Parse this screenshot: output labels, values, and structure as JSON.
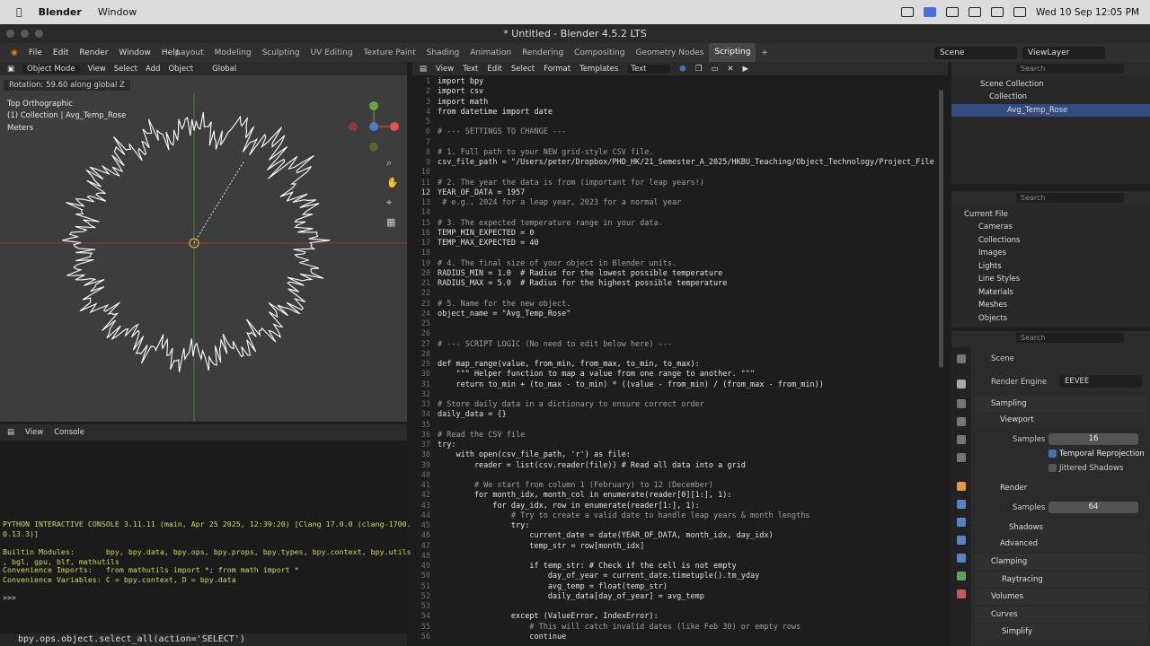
{
  "mac": {
    "apple": "",
    "app": "Blender",
    "menu": "Window",
    "clock": "Wed 10 Sep  12:05 PM"
  },
  "window": {
    "title": "* Untitled - Blender 4.5.2 LTS"
  },
  "menu": [
    "File",
    "Edit",
    "Render",
    "Window",
    "Help"
  ],
  "tabs": [
    "Layout",
    "Modeling",
    "Sculpting",
    "UV Editing",
    "Texture Paint",
    "Shading",
    "Animation",
    "Rendering",
    "Compositing",
    "Geometry Nodes",
    "Scripting"
  ],
  "scene": {
    "label": "Scene",
    "viewlayer": "ViewLayer"
  },
  "viewport": {
    "mode": "Object Mode",
    "menus": [
      "View",
      "Select",
      "Add",
      "Object"
    ],
    "orientation": "Global",
    "tip": "Rotation: 59.60 along global Z",
    "view": "Top Orthographic",
    "collection": "(1) Collection | Avg_Temp_Rose",
    "units": "Meters"
  },
  "console": {
    "menus": [
      "View",
      "Console"
    ],
    "lines": [
      "PYTHON INTERACTIVE CONSOLE 3.11.11 (main, Apr 25 2025, 12:39:20) [Clang 17.0.0 (clang-1700.",
      "0.13.3)]",
      "",
      "Builtin Modules:       bpy, bpy.data, bpy.ops, bpy.props, bpy.types, bpy.context, bpy.utils",
      ", bgl, gpu, blf, mathutils",
      "Convenience Imports:   from mathutils import *; from math import *",
      "Convenience Variables: C = bpy.context, D = bpy.data"
    ],
    "prompt": ">>> "
  },
  "statusbar": "bpy.ops.object.select_all(action='SELECT')",
  "editor": {
    "menus": [
      "View",
      "Text",
      "Edit",
      "Select",
      "Format",
      "Templates"
    ],
    "textname": "Text"
  },
  "code": [
    "import bpy",
    "import csv",
    "import math",
    "from datetime import date",
    "",
    "# --- SETTINGS TO CHANGE ---",
    "",
    "# 1. Full path to your NEW grid-style CSV file.",
    "csv_file_path = \"/Users/peter/Dropbox/PHD_HK/21_Semester_A_2025/HKBU_Teaching/Object_Technology/Project_File",
    "",
    "# 2. The year the data is from (important for leap years!)",
    "YEAR_OF_DATA = 1957",
    " # e.g., 2024 for a leap year, 2023 for a normal year",
    "",
    "# 3. The expected temperature range in your data.",
    "TEMP_MIN_EXPECTED = 0",
    "TEMP_MAX_EXPECTED = 40",
    "",
    "# 4. The final size of your object in Blender units.",
    "RADIUS_MIN = 1.0  # Radius for the lowest possible temperature",
    "RADIUS_MAX = 5.0  # Radius for the highest possible temperature",
    "",
    "# 5. Name for the new object.",
    "object_name = \"Avg_Temp_Rose\"",
    "",
    "",
    "# --- SCRIPT LOGIC (No need to edit below here) ---",
    "",
    "def map_range(value, from_min, from_max, to_min, to_max):",
    "    \"\"\" Helper function to map a value from one range to another. \"\"\"",
    "    return to_min + (to_max - to_min) * ((value - from_min) / (from_max - from_min))",
    "",
    "# Store daily data in a dictionary to ensure correct order",
    "daily_data = {}",
    "",
    "# Read the CSV file",
    "try:",
    "    with open(csv_file_path, 'r') as file:",
    "        reader = list(csv.reader(file)) # Read all data into a grid",
    "",
    "        # We start from column 1 (February) to 12 (December)",
    "        for month_idx, month_col in enumerate(reader[0][1:], 1):",
    "            for day_idx, row in enumerate(reader[1:], 1):",
    "                # Try to create a valid date to handle leap years & month lengths",
    "                try:",
    "                    current_date = date(YEAR_OF_DATA, month_idx, day_idx)",
    "                    temp_str = row[month_idx]",
    "",
    "                    if temp_str: # Check if the cell is not empty",
    "                        day_of_year = current_date.timetuple().tm_yday",
    "                        avg_temp = float(temp_str)",
    "                        daily_data[day_of_year] = avg_temp",
    "",
    "                except (ValueError, IndexError):",
    "                    # This will catch invalid dates (like Feb 30) or empty rows",
    "                    continue"
  ],
  "outliner": {
    "root": "Scene Collection",
    "collection": "Collection",
    "object": "Avg_Temp_Rose",
    "search": "Search"
  },
  "blendfile": {
    "current": "Current File",
    "items": [
      "Cameras",
      "Collections",
      "Images",
      "Lights",
      "Line Styles",
      "Materials",
      "Meshes",
      "Objects"
    ]
  },
  "props": {
    "scene": "Scene",
    "engine_label": "Render Engine",
    "engine": "EEVEE",
    "sampling": "Sampling",
    "viewport": "Viewport",
    "samples_label": "Samples",
    "vp_samples": "16",
    "temporal": "Temporal Reprojection",
    "jittered": "Jittered Shadows",
    "render": "Render",
    "r_samples": "64",
    "shadows": "Shadows",
    "advanced": "Advanced",
    "clamping": "Clamping",
    "raytracing": "Raytracing",
    "volumes": "Volumes",
    "curves": "Curves",
    "simplify": "Simplify"
  }
}
